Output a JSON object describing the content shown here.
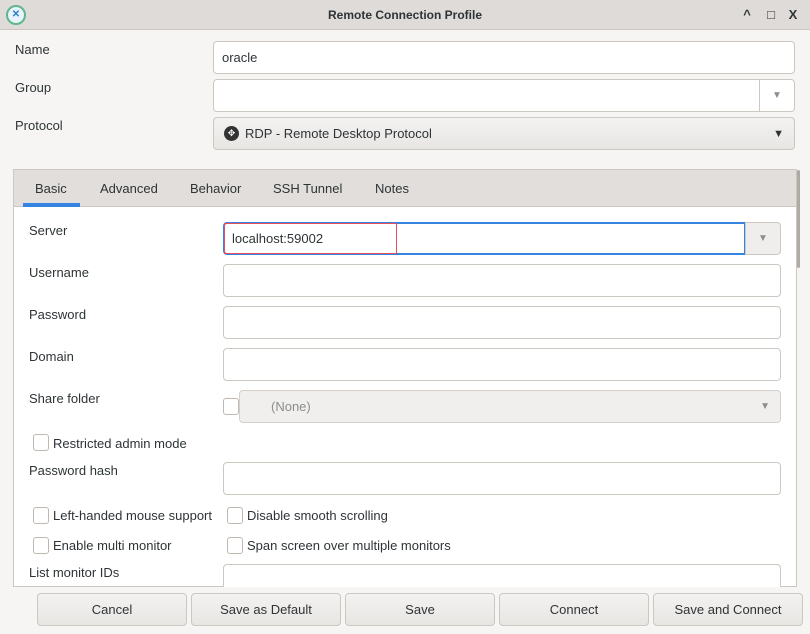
{
  "window": {
    "title": "Remote Connection Profile",
    "controls": {
      "minimize": "^",
      "maximize": "□",
      "close": "X"
    }
  },
  "form": {
    "name_label": "Name",
    "name_value": "oracle",
    "group_label": "Group",
    "group_value": "",
    "protocol_label": "Protocol",
    "protocol_value": "RDP - Remote Desktop Protocol"
  },
  "tabs": [
    {
      "label": "Basic",
      "active": true
    },
    {
      "label": "Advanced"
    },
    {
      "label": "Behavior"
    },
    {
      "label": "SSH Tunnel"
    },
    {
      "label": "Notes"
    }
  ],
  "basic": {
    "server_label": "Server",
    "server_value": "localhost:59002",
    "username_label": "Username",
    "username_value": "",
    "password_label": "Password",
    "password_value": "",
    "domain_label": "Domain",
    "domain_value": "",
    "share_folder_label": "Share folder",
    "share_folder_value": "(None)",
    "share_folder_checked": false,
    "restricted_admin_label": "Restricted admin mode",
    "restricted_admin_checked": false,
    "password_hash_label": "Password hash",
    "password_hash_value": "",
    "left_handed_label": "Left-handed mouse support",
    "left_handed_checked": false,
    "disable_smooth_label": "Disable smooth scrolling",
    "disable_smooth_checked": false,
    "multi_monitor_label": "Enable multi monitor",
    "multi_monitor_checked": false,
    "span_screen_label": "Span screen over multiple monitors",
    "span_screen_checked": false,
    "monitor_ids_label": "List monitor IDs",
    "monitor_ids_value": ""
  },
  "buttons": {
    "cancel": "Cancel",
    "save_default": "Save as Default",
    "save": "Save",
    "connect": "Connect",
    "save_connect": "Save and Connect"
  },
  "colors": {
    "accent": "#3584e4",
    "highlight": "#e5505a"
  }
}
